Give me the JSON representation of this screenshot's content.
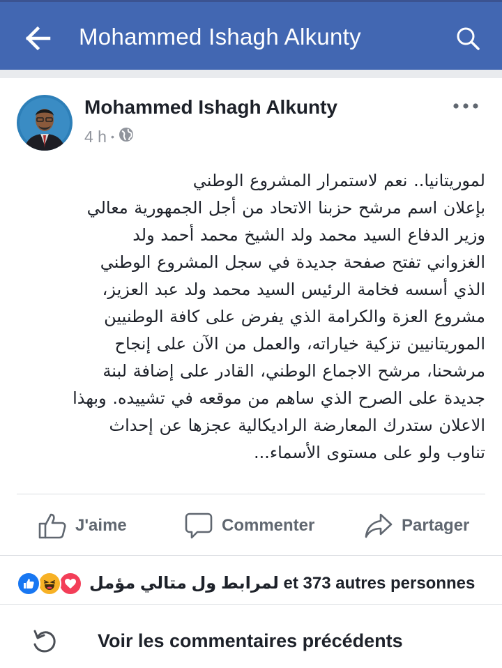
{
  "header": {
    "title": "Mohammed Ishagh Alkunty",
    "back_icon": "back-arrow-icon",
    "search_icon": "search-icon",
    "background_color": "#4267b2"
  },
  "post": {
    "author": "Mohammed Ishagh Alkunty",
    "time": "4 h",
    "separator": "•",
    "audience_icon": "globe-icon",
    "more_icon": "more-dots-icon",
    "text_lines": [
      "لموريتانيا.. نعم  لاستمرار المشروع الوطني",
      "بإعلان اسم مرشح حزبنا الاتحاد من أجل الجمهورية معالي",
      "وزير الدفاع السيد محمد ولد الشيخ محمد أحمد ولد",
      "الغزواني تفتح صفحة جديدة في سجل المشروع الوطني",
      "الذي أسسه فخامة الرئيس السيد محمد ولد عبد العزيز،",
      "مشروع العزة والكرامة الذي يفرض على كافة الوطنيين",
      "الموريتانيين تزكية خياراته، والعمل من الآن على إنجاح",
      "مرشحنا، مرشح الاجماع الوطني، القادر على إضافة لبنة",
      "جديدة على الصرح الذي ساهم من موقعه في تشييده. وبهذا",
      "الاعلان ستدرك المعارضة الراديكالية عجزها عن إحداث",
      "تناوب ولو على مستوى الأسماء..."
    ]
  },
  "actions": {
    "like_label": "J'aime",
    "comment_label": "Commenter",
    "share_label": "Partager"
  },
  "reactions": {
    "icons": [
      "like-reaction-icon",
      "haha-reaction-icon",
      "love-reaction-icon"
    ],
    "summary": "لمرابط ول متالي مؤمل et 373 autres personnes",
    "colors": {
      "like": "#1877f2",
      "haha": "#f7b125",
      "love": "#f33e58"
    }
  },
  "comments": {
    "previous_label": "Voir les commentaires précédents"
  }
}
